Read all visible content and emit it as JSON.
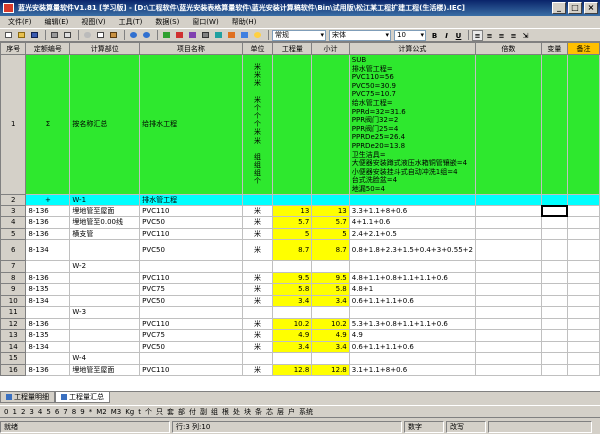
{
  "title": "蓝光安装算量软件V1.81 [学习版] - [D:\\工程软件\\蓝光安装表格算量软件\\蓝光安装计算稿软件\\Bin\\试用版\\松江某工程扩建工程(生活楼).IEC]",
  "menu": [
    "文件(F)",
    "编辑(E)",
    "视图(V)",
    "工具(T)",
    "数据(S)",
    "窗口(W)",
    "帮助(H)"
  ],
  "toolbar": {
    "style_combo": "常规",
    "font_combo": "宋体",
    "size_combo": "10",
    "bold": "B",
    "italic": "I",
    "underline": "U"
  },
  "columns": [
    "序号",
    "定额编号",
    "计算部位",
    "项目名称",
    "单位",
    "工程量",
    "小计",
    "计算公式",
    "倍数",
    "变量",
    "备注"
  ],
  "row1": {
    "num": "1",
    "code": "Σ",
    "part": "按名称汇总",
    "name": "给排水工程",
    "unit_lines": [
      "米",
      "米",
      "米",
      "",
      "米",
      "个",
      "个",
      "个",
      "米",
      "米",
      "",
      "组",
      "组",
      "组",
      "个"
    ],
    "formula_lines": [
      "SUB",
      "排水管工程=",
      "PVC110=56",
      "PVC50=30.9",
      "PVC75=10.7",
      "给水管工程=",
      "PPRd=32=31.6",
      "PPR阀门32=2",
      "PPR阀门25=4",
      "PPRDe25=26.4",
      "PPRDe20=13.8",
      "卫生洁具=",
      "大便器安装蹲式液压水箱铜管镶嵌=4",
      "小便器安装挂斗式自动冲洗1组=4",
      "台式洗脸盆=4",
      "地漏50=4"
    ]
  },
  "row2": {
    "num": "2",
    "code": "+",
    "part": "W-1",
    "name": "排水管工程"
  },
  "rows": [
    {
      "num": "3",
      "code": "8-136",
      "part": "埋地管至屋面",
      "name": "PVC110",
      "unit": "米",
      "qty": "13",
      "sub": "13",
      "formula": "3.3+1.1+8+0.6",
      "yellow": true,
      "tall": false,
      "sel": true
    },
    {
      "num": "4",
      "code": "8-136",
      "part": "埋地管至0.00线",
      "name": "PVC50",
      "unit": "米",
      "qty": "5.7",
      "sub": "5.7",
      "formula": "4+1.1+0.6",
      "yellow": true,
      "tall": false,
      "sel": false
    },
    {
      "num": "5",
      "code": "8-136",
      "part": "横支管",
      "name": "PVC110",
      "unit": "米",
      "qty": "5",
      "sub": "5",
      "formula": "2.4+2.1+0.5",
      "yellow": true,
      "tall": false,
      "sel": false
    },
    {
      "num": "6",
      "code": "8-134",
      "part": "",
      "name": "PVC50",
      "unit": "米",
      "qty": "8.7",
      "sub": "8.7",
      "formula": "0.8+1.8+2.3+1.5+0.4+3+0.55+2",
      "yellow": true,
      "tall": true,
      "sel": false
    },
    {
      "num": "7",
      "code": "",
      "part": "W-2",
      "name": "",
      "unit": "",
      "qty": "",
      "sub": "",
      "formula": "",
      "yellow": false,
      "tall": false,
      "sel": false
    },
    {
      "num": "8",
      "code": "8-136",
      "part": "",
      "name": "PVC110",
      "unit": "米",
      "qty": "9.5",
      "sub": "9.5",
      "formula": "4.8+1.1+0.8+1.1+1.1+0.6",
      "yellow": true,
      "tall": false,
      "sel": false
    },
    {
      "num": "9",
      "code": "8-135",
      "part": "",
      "name": "PVC75",
      "unit": "米",
      "qty": "5.8",
      "sub": "5.8",
      "formula": "4.8+1",
      "yellow": true,
      "tall": false,
      "sel": false
    },
    {
      "num": "10",
      "code": "8-134",
      "part": "",
      "name": "PVC50",
      "unit": "米",
      "qty": "3.4",
      "sub": "3.4",
      "formula": "0.6+1.1+1.1+0.6",
      "yellow": true,
      "tall": false,
      "sel": false
    },
    {
      "num": "11",
      "code": "",
      "part": "W-3",
      "name": "",
      "unit": "",
      "qty": "",
      "sub": "",
      "formula": "",
      "yellow": false,
      "tall": false,
      "sel": false
    },
    {
      "num": "12",
      "code": "8-136",
      "part": "",
      "name": "PVC110",
      "unit": "米",
      "qty": "10.2",
      "sub": "10.2",
      "formula": "5.3+1.3+0.8+1.1+1.1+0.6",
      "yellow": true,
      "tall": false,
      "sel": false
    },
    {
      "num": "13",
      "code": "8-135",
      "part": "",
      "name": "PVC75",
      "unit": "米",
      "qty": "4.9",
      "sub": "4.9",
      "formula": "4.9",
      "yellow": true,
      "tall": false,
      "sel": false
    },
    {
      "num": "14",
      "code": "8-134",
      "part": "",
      "name": "PVC50",
      "unit": "米",
      "qty": "3.4",
      "sub": "3.4",
      "formula": "0.6+1.1+1.1+0.6",
      "yellow": true,
      "tall": false,
      "sel": false
    },
    {
      "num": "15",
      "code": "",
      "part": "W-4",
      "name": "",
      "unit": "",
      "qty": "",
      "sub": "",
      "formula": "",
      "yellow": false,
      "tall": false,
      "sel": false
    },
    {
      "num": "16",
      "code": "8-136",
      "part": "埋地管至屋面",
      "name": "PVC110",
      "unit": "米",
      "qty": "12.8",
      "sub": "12.8",
      "formula": "3.1+1.1+8+0.6",
      "yellow": true,
      "tall": false,
      "sel": false
    }
  ],
  "tabs": [
    "工程量明细",
    "工程量汇总"
  ],
  "symbols": [
    "0",
    "1",
    "2",
    "3",
    "4",
    "5",
    "6",
    "7",
    "8",
    "9",
    "*",
    "M2",
    "M3",
    "Kg",
    "t",
    "个",
    "只",
    "套",
    "部",
    "付",
    "副",
    "组",
    "根",
    "处",
    "块",
    "条",
    "芯",
    "层",
    "户",
    "系统"
  ],
  "status": {
    "ready": "就绪",
    "position": "行:3 列:10",
    "num": "数字",
    "modified": "改写"
  }
}
